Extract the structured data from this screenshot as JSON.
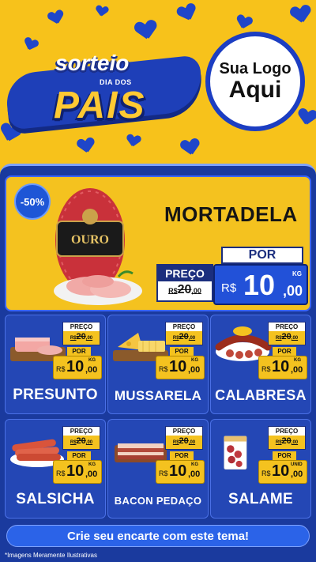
{
  "header": {
    "campaign_line1": "sorteio",
    "campaign_line2": "DIA DOS",
    "campaign_line3": "PAIS",
    "logo_line1": "Sua Logo",
    "logo_line2": "Aqui"
  },
  "featured": {
    "discount": "-50%",
    "name": "MORTADELA",
    "package_brand": "OURO",
    "preco_label": "PREÇO",
    "old_price_int": "20",
    "old_price_dec": ",00",
    "old_price_prefix": "R$",
    "por_label": "POR",
    "currency": "R$",
    "price_int": "10",
    "price_dec": ",00",
    "unit": "KG"
  },
  "products": [
    {
      "name": "PRESUNTO",
      "preco_label": "PREÇO",
      "old_prefix": "R$",
      "old_int": "20",
      "old_dec": ",00",
      "por_label": "POR",
      "currency": "R$",
      "price_int": "10",
      "price_dec": ",00",
      "unit": "KG"
    },
    {
      "name": "MUSSARELA",
      "preco_label": "PREÇO",
      "old_prefix": "R$",
      "old_int": "20",
      "old_dec": ",00",
      "por_label": "POR",
      "currency": "R$",
      "price_int": "10",
      "price_dec": ",00",
      "unit": "KG"
    },
    {
      "name": "CALABRESA",
      "preco_label": "PREÇO",
      "old_prefix": "R$",
      "old_int": "20",
      "old_dec": ",00",
      "por_label": "POR",
      "currency": "R$",
      "price_int": "10",
      "price_dec": ",00",
      "unit": "KG"
    },
    {
      "name": "SALSICHA",
      "preco_label": "PREÇO",
      "old_prefix": "R$",
      "old_int": "20",
      "old_dec": ",00",
      "por_label": "POR",
      "currency": "R$",
      "price_int": "10",
      "price_dec": ",00",
      "unit": "KG"
    },
    {
      "name": "BACON PEDAÇO",
      "preco_label": "PREÇO",
      "old_prefix": "R$",
      "old_int": "20",
      "old_dec": ",00",
      "por_label": "POR",
      "currency": "R$",
      "price_int": "10",
      "price_dec": ",00",
      "unit": "KG"
    },
    {
      "name": "SALAME",
      "preco_label": "PREÇO",
      "old_prefix": "R$",
      "old_int": "20",
      "old_dec": ",00",
      "por_label": "POR",
      "currency": "R$",
      "price_int": "10",
      "price_dec": ",00",
      "unit": "UNID"
    }
  ],
  "cta": {
    "label": "Crie seu encarte com este tema!"
  },
  "disclaimer": "*Imagens Meramente Ilustrativas",
  "colors": {
    "background_yellow": "#f7c21b",
    "panel_blue": "#1a3a9e",
    "card_blue": "#2447b5",
    "price_blue": "#2251d8"
  }
}
